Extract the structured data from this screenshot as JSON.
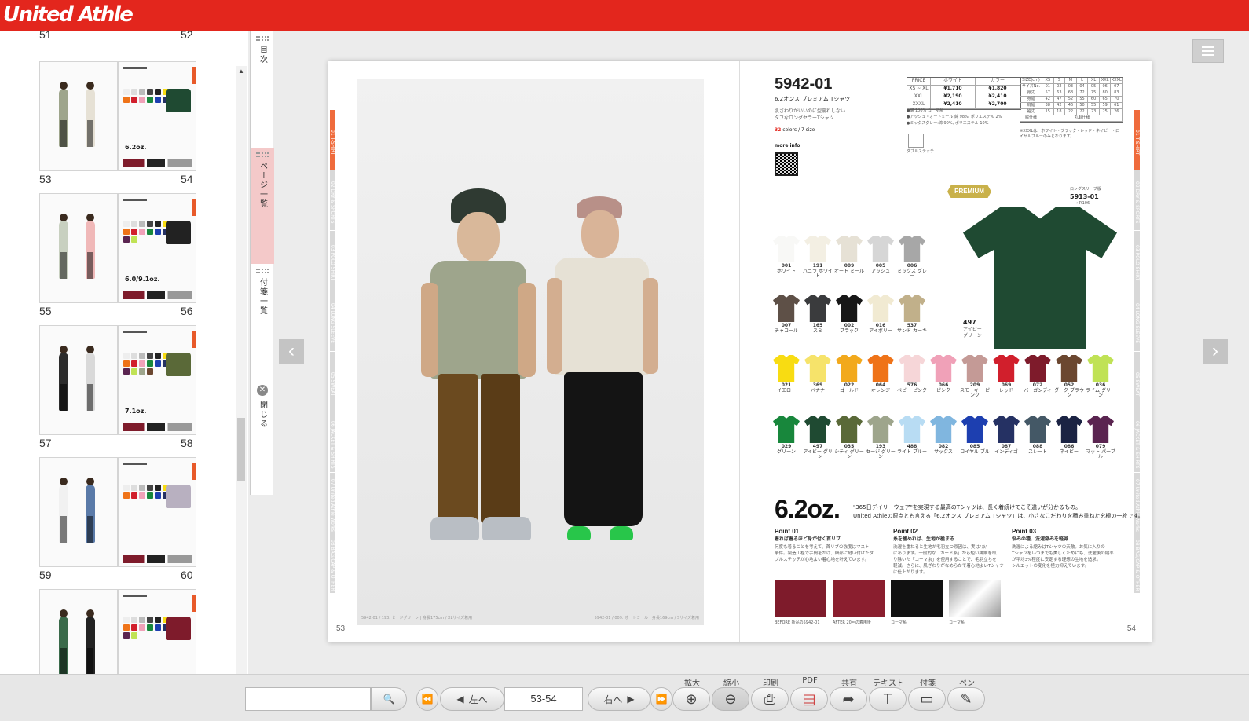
{
  "header": {
    "logo_text": "United Athle",
    "brand_color": "#e3261d"
  },
  "sidebar": {
    "top_pages": [
      "51",
      "52"
    ],
    "thumbnails": [
      {
        "left": "53",
        "right": "54",
        "right_title": "6.2oz."
      },
      {
        "left": "55",
        "right": "56",
        "right_title": "6.0/9.1oz."
      },
      {
        "left": "57",
        "right": "58",
        "right_title": "7.1oz."
      },
      {
        "left": "59",
        "right": "60",
        "right_title": ""
      },
      {
        "left": "61",
        "right": "62",
        "right_title": ""
      }
    ]
  },
  "side_tabs": [
    {
      "label": "目次",
      "icon": "grip-icon"
    },
    {
      "label": "ページ一覧",
      "icon": "grip-icon",
      "active": true
    },
    {
      "label": "付箋一覧",
      "icon": "grip-icon"
    },
    {
      "label": "閉じる",
      "icon": "close-icon"
    }
  ],
  "viewer": {
    "spread": {
      "left_page_number": "53",
      "right_page_number": "54",
      "category_tabs": [
        "01 T-SHIRT",
        "02 DRY & SPORTS",
        "03 POLO SHIRT",
        "04 LONG SLEEVE",
        "05 SWEAT",
        "06 JACKET & SHIRTS",
        "07 United Athle Works",
        "08 BAG/CAP & OTHER"
      ],
      "photo_caption_left": "5942-01 / 193. セージグリーン | 身長175cm / XLサイズ着用",
      "photo_caption_right": "5942-01 / 009. オートミール | 身長169cm / Sサイズ着用",
      "product": {
        "code": "5942-01",
        "name": "6.2オンス プレミアム Tシャツ",
        "tagline_1": "肌ざわりがいいのに型崩れしない",
        "tagline_2": "タフなロングセラーTシャツ",
        "colors_count": "32",
        "colors_label": " colors / 7 size",
        "more_info": "more info",
        "premium_badge": "PREMIUM",
        "long_sleeve_label": "ロングスリーブ版",
        "long_sleeve_code": "5913-01",
        "long_sleeve_page": "→ P.106",
        "featured_color": {
          "code": "497",
          "name": "アイビー グリーン",
          "hex": "#1f4a32"
        },
        "price_header": [
          "PRICE",
          "ホワイト",
          "カラー"
        ],
        "price_rows": [
          [
            "XS ~ XL",
            "¥1,710",
            "¥1,820"
          ],
          [
            "XXL",
            "¥2,190",
            "¥2,410"
          ],
          [
            "XXXL",
            "¥2,410",
            "¥2,700"
          ]
        ],
        "size_header": [
          "SIZE(cm)",
          "XS",
          "S",
          "M",
          "L",
          "XL",
          "XXL",
          "XXXL"
        ],
        "size_rows": [
          [
            "サイズNo.",
            "01",
            "02",
            "03",
            "04",
            "05",
            "06",
            "07"
          ],
          [
            "身丈",
            "57",
            "63",
            "68",
            "72",
            "75",
            "80",
            "83"
          ],
          [
            "身幅",
            "42",
            "47",
            "52",
            "55",
            "60",
            "65",
            "70"
          ],
          [
            "肩幅",
            "38",
            "42",
            "46",
            "50",
            "55",
            "59",
            "61"
          ],
          [
            "袖丈",
            "15",
            "18",
            "22",
            "22",
            "23",
            "25",
            "26"
          ],
          [
            "脇仕様",
            "丸胴仕様"
          ]
        ],
        "material_notes": [
          "●綿 100% コーマ糸",
          "●アッシュ・オートミール:綿 98%, ポリエステル 2%",
          "●ミックスグレー:綿 90%, ポリエステル 10%"
        ],
        "size_note": "※XXXLは、ホワイト・ブラック・レッド・ネイビー・ロイヤルブルーのみとなります。",
        "stitch_label": "ダブルステッチ",
        "swatch_rows": [
          [
            {
              "code": "001",
              "name": "ホワイト",
              "hex": "#f8f8f6"
            },
            {
              "code": "191",
              "name": "バニラ ホワイト",
              "hex": "#f3efe3"
            },
            {
              "code": "009",
              "name": "オート ミール",
              "hex": "#e6e1d5"
            },
            {
              "code": "005",
              "name": "アッシュ",
              "hex": "#d6d6d6"
            },
            {
              "code": "006",
              "name": "ミックス グレー",
              "hex": "#a7a7a7"
            }
          ],
          [
            {
              "code": "007",
              "name": "チャコール",
              "hex": "#5e5047"
            },
            {
              "code": "165",
              "name": "スミ",
              "hex": "#3a3b3d"
            },
            {
              "code": "002",
              "name": "ブラック",
              "hex": "#171717"
            },
            {
              "code": "016",
              "name": "アイボリー",
              "hex": "#f1ead2"
            },
            {
              "code": "537",
              "name": "サンド カーキ",
              "hex": "#c1b08a"
            }
          ],
          [
            {
              "code": "021",
              "name": "イエロー",
              "hex": "#f8dc12"
            },
            {
              "code": "369",
              "name": "バナナ",
              "hex": "#f6e36a"
            },
            {
              "code": "022",
              "name": "ゴールド",
              "hex": "#f2a91c"
            },
            {
              "code": "064",
              "name": "オレンジ",
              "hex": "#ef7318"
            },
            {
              "code": "576",
              "name": "ベビー ピンク",
              "hex": "#f6d6d8"
            },
            {
              "code": "066",
              "name": "ピンク",
              "hex": "#f0a1b8"
            },
            {
              "code": "209",
              "name": "スモーキー ピンク",
              "hex": "#c49a96"
            },
            {
              "code": "069",
              "name": "レッド",
              "hex": "#d11f2c"
            },
            {
              "code": "072",
              "name": "バーガンディ",
              "hex": "#7e1b2b"
            },
            {
              "code": "052",
              "name": "ダーク ブラウン",
              "hex": "#6b4730"
            },
            {
              "code": "036",
              "name": "ライム グリーン",
              "hex": "#c0e255"
            }
          ],
          [
            {
              "code": "029",
              "name": "グリーン",
              "hex": "#18873c"
            },
            {
              "code": "497",
              "name": "アイビー グリーン",
              "hex": "#1f4a32"
            },
            {
              "code": "035",
              "name": "シティ グリーン",
              "hex": "#5a6938"
            },
            {
              "code": "193",
              "name": "セージ グリーン",
              "hex": "#9ea58c"
            },
            {
              "code": "488",
              "name": "ライト ブルー",
              "hex": "#b8dcf3"
            },
            {
              "code": "082",
              "name": "サックス",
              "hex": "#80b6df"
            },
            {
              "code": "085",
              "name": "ロイヤル ブルー",
              "hex": "#1d3fb0"
            },
            {
              "code": "087",
              "name": "インディゴ",
              "hex": "#253163"
            },
            {
              "code": "088",
              "name": "スレート",
              "hex": "#445866"
            },
            {
              "code": "086",
              "name": "ネイビー",
              "hex": "#1b2343"
            },
            {
              "code": "079",
              "name": "マット パープル",
              "hex": "#5a2450"
            }
          ]
        ],
        "weight": "6.2oz.",
        "weight_desc_1": "\"365日デイリーウェア\"を実現する最高のTシャツは、長く着続けてこそ違いが分かるもの。",
        "weight_desc_2": "United Athleの原点とも言える「6.2オンス プレミアム Tシャツ」は、小さなこだわりを積み重ねた究極の一枚です。",
        "points": [
          {
            "title": "Point 01",
            "subtitle": "着れば着るほど身が付く首リブ",
            "lines": [
              "何度も着ることを考えて、首リブの強度はマスト",
              "条件。製造工程で手間をかけ、細部に縫い付けたダ",
              "ブルステッチが心地よい着心地を叶えています。"
            ]
          },
          {
            "title": "Point 02",
            "subtitle": "糸を極めれば、生地が極まる",
            "lines": [
              "洗濯を重ねると生地が毛羽立つ原因は、実は\"糸\"",
              "にあります。一般的な「カード糸」から短い繊維を取",
              "り除いた「コーマ糸」を使用することで、毛羽立ちを",
              "軽減。さらに、肌ざわりがなめらかで着心地よいTシャツ",
              "に仕上がります。"
            ]
          },
          {
            "title": "Point 03",
            "subtitle": "悩みの種、洗濯縮みを軽減",
            "lines": [
              "洗濯による縮みはTシャツの天敵。お気に入りの",
              "Tシャツをいつまでも美しくためにも、洗濯後の縮率",
              "が平均3%程度に安定する理想の生地を追求。",
              "シルエットの変化を極力抑えています。"
            ]
          }
        ],
        "detail_captions": [
          "BEFORE 新品の5942-01",
          "AFTER 20回の着用後",
          "コーマ糸",
          "コーマ糸"
        ]
      }
    }
  },
  "toolbar": {
    "search_placeholder": "",
    "prev_label": "左へ",
    "page_value": "53-54",
    "next_label": "右へ",
    "labels": [
      "拡大",
      "縮小",
      "印刷",
      "PDF",
      "共有",
      "テキスト",
      "付箋",
      "ペン"
    ]
  }
}
